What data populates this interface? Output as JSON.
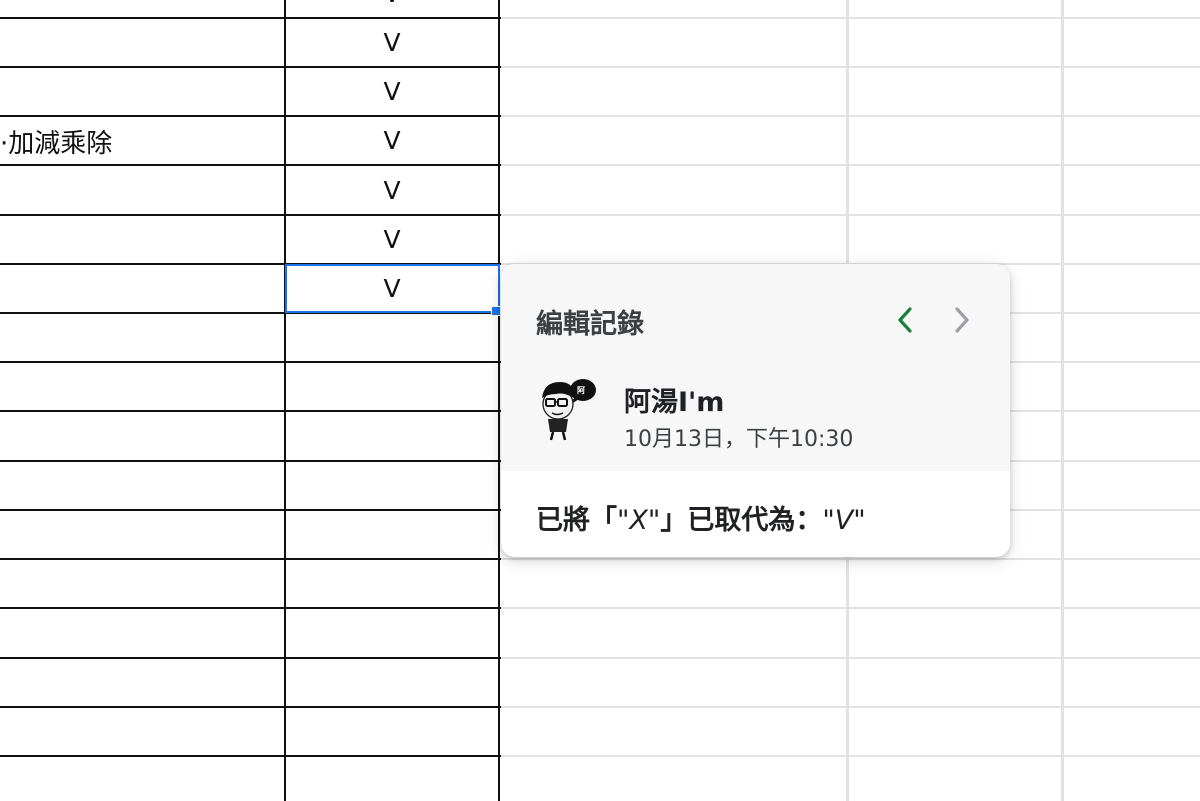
{
  "sheet": {
    "partial_cell_text": "·加減乘除",
    "check_values": [
      "V",
      "V",
      "V",
      "V",
      "V",
      "V",
      "V"
    ]
  },
  "history_popup": {
    "title": "編輯記錄",
    "prev_icon": "chevron-left-icon",
    "next_icon": "chevron-right-icon",
    "prev_color": "#188038",
    "next_color": "#9aa0a6",
    "user_name": "阿湯I'm",
    "timestamp": "10月13日，下午10:30",
    "change_prefix": "已將「",
    "old_value": "\"X\"",
    "change_middle": "」已取代為：",
    "new_value": "\"V\""
  },
  "colors": {
    "selection": "#1a73e8",
    "dark_grid": "#111111",
    "light_grid": "#e2e2e2"
  }
}
